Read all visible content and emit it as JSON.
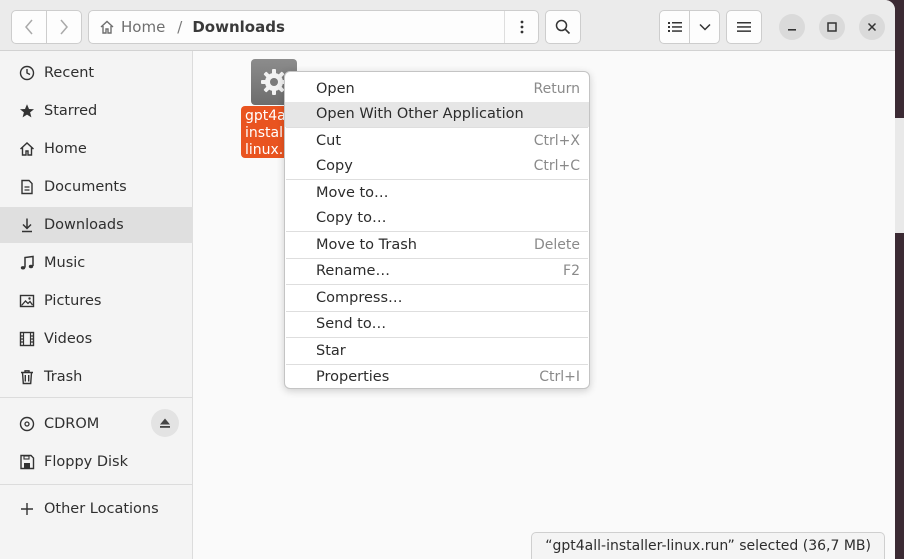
{
  "window": {
    "nav_back_icon": "chevron-left-icon",
    "nav_forward_icon": "chevron-right-icon"
  },
  "path": {
    "home_label": "Home",
    "separator": "/",
    "current": "Downloads"
  },
  "sidebar": {
    "items": [
      {
        "label": "Recent",
        "icon": "clock-icon"
      },
      {
        "label": "Starred",
        "icon": "star-icon"
      },
      {
        "label": "Home",
        "icon": "home-icon"
      },
      {
        "label": "Documents",
        "icon": "document-icon"
      },
      {
        "label": "Downloads",
        "icon": "download-icon"
      },
      {
        "label": "Music",
        "icon": "music-note-icon"
      },
      {
        "label": "Pictures",
        "icon": "picture-icon"
      },
      {
        "label": "Videos",
        "icon": "film-icon"
      },
      {
        "label": "Trash",
        "icon": "trash-icon"
      }
    ],
    "devices": [
      {
        "label": "CDROM",
        "icon": "disc-icon"
      },
      {
        "label": "Floppy Disk",
        "icon": "floppy-icon"
      }
    ],
    "other_locations": "Other Locations",
    "active_item": "Downloads"
  },
  "file": {
    "label_lines": [
      "gpt4a",
      "instal",
      "linux.r"
    ],
    "icon": "gear-icon"
  },
  "context_menu": {
    "groups": [
      [
        {
          "label": "Open",
          "accel": "Return"
        },
        {
          "label": "Open With Other Application",
          "accel": ""
        }
      ],
      [
        {
          "label": "Cut",
          "accel": "Ctrl+X"
        },
        {
          "label": "Copy",
          "accel": "Ctrl+C"
        }
      ],
      [
        {
          "label": "Move to…",
          "accel": ""
        },
        {
          "label": "Copy to…",
          "accel": ""
        }
      ],
      [
        {
          "label": "Move to Trash",
          "accel": "Delete"
        }
      ],
      [
        {
          "label": "Rename…",
          "accel": "F2"
        }
      ],
      [
        {
          "label": "Compress…",
          "accel": ""
        }
      ],
      [
        {
          "label": "Send to…",
          "accel": ""
        }
      ],
      [
        {
          "label": "Star",
          "accel": ""
        }
      ],
      [
        {
          "label": "Properties",
          "accel": "Ctrl+I"
        }
      ]
    ],
    "hovered": "Open With Other Application"
  },
  "status": {
    "text": "“gpt4all-installer-linux.run” selected  (36,7 MB)"
  },
  "colors": {
    "accent": "#e95420",
    "headerbar": "#ebebeb",
    "sidebar": "#f4f4f4",
    "desktop": "#3b2a33"
  }
}
